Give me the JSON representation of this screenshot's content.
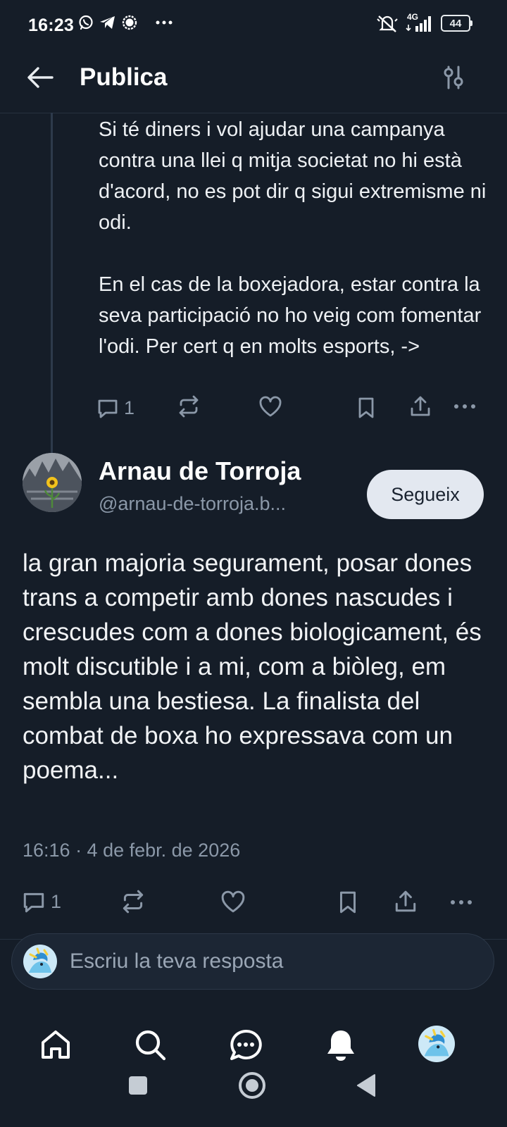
{
  "status_bar": {
    "time": "16:23",
    "network": "4G",
    "battery": "44",
    "icons": [
      "whatsapp-icon",
      "telegram-icon",
      "signal-icon",
      "more-dots-icon",
      "mute-icon",
      "signal-bars-icon",
      "battery-icon"
    ]
  },
  "header": {
    "title": "Publica",
    "back_icon": "arrow-left-icon",
    "filter_icon": "sliders-icon"
  },
  "previous_post": {
    "paragraph1": "Si té diners i vol ajudar una campanya contra una llei q mitja societat no hi està d'acord, no es pot dir q sigui extremisme ni odi.",
    "paragraph2": "En el cas de la boxejadora, estar contra la seva participació no ho veig com fomentar l'odi. Per cert q en molts esports, ->",
    "reply_count": "1"
  },
  "main_post": {
    "author_name": "Arnau de Torroja",
    "author_handle": "@arnau-de-torroja.b...",
    "follow_label": "Segueix",
    "text": "la gran majoria segurament, posar dones trans a competir amb dones nascudes i crescudes com a dones biologicament, és molt discutible i a mi, com a biòleg, em sembla una bestiesa. La finalista del combat de boxa ho expressava com un poema...",
    "timestamp": "16:16 · 4 de febr. de 2026",
    "reply_count": "1"
  },
  "reply": {
    "placeholder": "Escriu la teva resposta"
  },
  "bottom_nav": {
    "items": [
      "home-icon",
      "search-icon",
      "chat-icon",
      "bell-icon",
      "profile-avatar"
    ]
  },
  "colors": {
    "background": "#151d28",
    "muted": "#8b98a8",
    "follow_button": "#e3e8f0"
  }
}
